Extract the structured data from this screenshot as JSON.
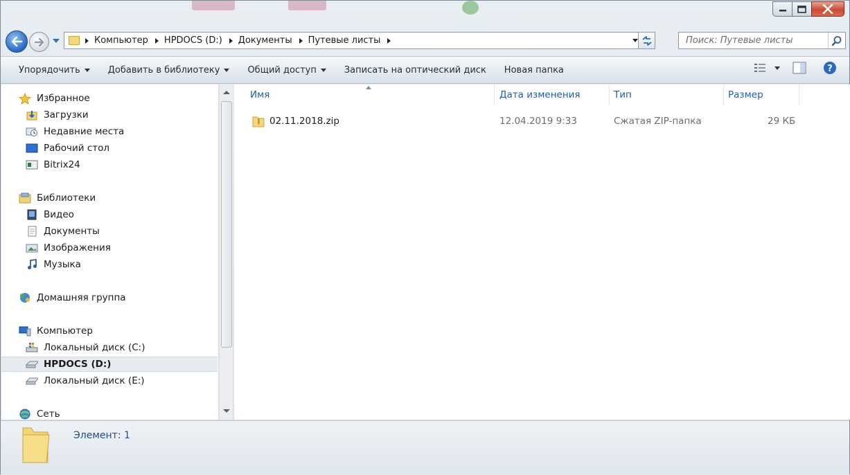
{
  "window": {
    "controls": {
      "minimize": "minimize-icon",
      "maximize": "maximize-icon",
      "close": "close-icon"
    }
  },
  "address": {
    "crumbs": [
      "Компьютер",
      "HPDOCS (D:)",
      "Документы",
      "Путевые листы"
    ],
    "search_placeholder": "Поиск: Путевые листы"
  },
  "toolbar": {
    "organize": "Упорядочить",
    "add_to_library": "Добавить в библиотеку",
    "share": "Общий доступ",
    "burn": "Записать на оптический диск",
    "new_folder": "Новая папка"
  },
  "nav": {
    "favorites": "Избранное",
    "downloads": "Загрузки",
    "recent": "Недавние места",
    "desktop": "Рабочий стол",
    "bitrix": "Bitrix24",
    "libraries": "Библиотеки",
    "video": "Видео",
    "documents": "Документы",
    "images": "Изображения",
    "music": "Музыка",
    "homegroup": "Домашняя группа",
    "computer": "Компьютер",
    "drive_c": "Локальный диск (C:)",
    "drive_d": "HPDOCS (D:)",
    "drive_e": "Локальный диск (E:)",
    "network": "Сеть"
  },
  "columns": {
    "name": "Имя",
    "date": "Дата изменения",
    "type": "Тип",
    "size": "Размер"
  },
  "files": [
    {
      "name": "02.11.2018.zip",
      "date": "12.04.2019 9:33",
      "type": "Сжатая ZIP-папка",
      "size": "29 КБ"
    }
  ],
  "status": {
    "count": "Элемент: 1"
  },
  "colors": {
    "accent": "#1f5da4",
    "selection": "#e7eaee",
    "folder": "#f3d779"
  }
}
